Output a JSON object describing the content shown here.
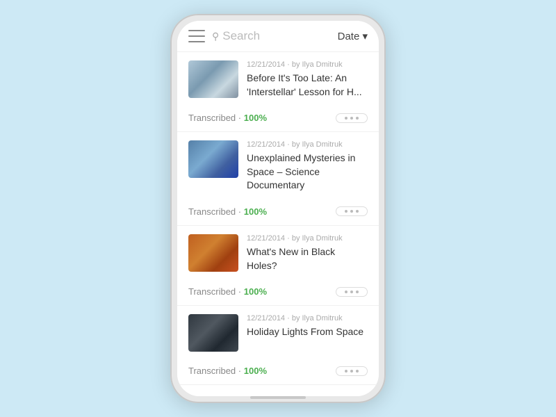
{
  "header": {
    "search_placeholder": "Search",
    "date_filter_label": "Date ▾",
    "menu_label": "Menu"
  },
  "cards": [
    {
      "date_author": "12/21/2014 · by Ilya Dmitruk",
      "title": "Before It's Too Late: An 'Interstellar' Lesson for H...",
      "transcribed_label": "Transcribed",
      "transcribed_pct": "100%",
      "thumb_class": "thumb-1"
    },
    {
      "date_author": "12/21/2014 · by Ilya Dmitruk",
      "title": "Unexplained Mysteries in Space – Science Documentary",
      "transcribed_label": "Transcribed",
      "transcribed_pct": "100%",
      "thumb_class": "thumb-2"
    },
    {
      "date_author": "12/21/2014 · by Ilya Dmitruk",
      "title": "What's New in Black Holes?",
      "transcribed_label": "Transcribed",
      "transcribed_pct": "100%",
      "thumb_class": "thumb-3"
    },
    {
      "date_author": "12/21/2014 · by Ilya Dmitruk",
      "title": "Holiday Lights From Space",
      "transcribed_label": "Transcribed",
      "transcribed_pct": "100%",
      "thumb_class": "thumb-4"
    }
  ],
  "separator": "·"
}
